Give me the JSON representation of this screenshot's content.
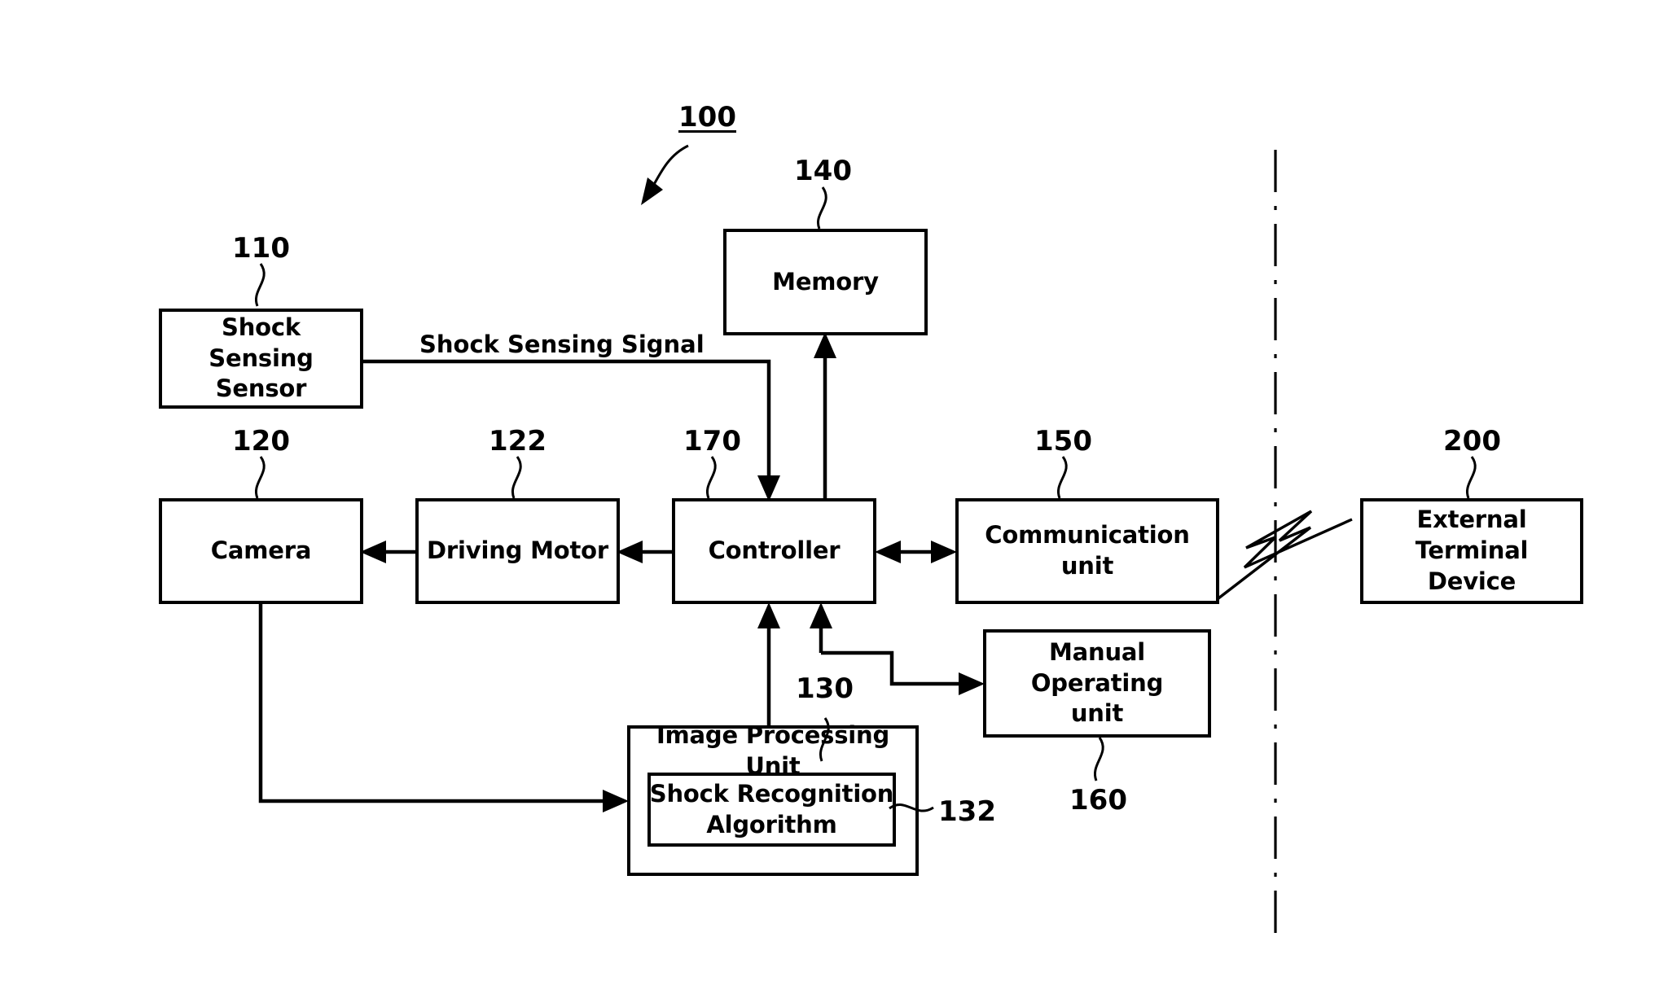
{
  "figure": {
    "system_ref": "100",
    "signal_labels": [
      {
        "id": "shock-sensing-signal",
        "text": "Shock Sensing Signal"
      }
    ]
  },
  "blocks": [
    {
      "id": "shock-sensing-sensor",
      "label": "Shock\nSensing Sensor",
      "ref": "110"
    },
    {
      "id": "camera",
      "label": "Camera",
      "ref": "120"
    },
    {
      "id": "driving-motor",
      "label": "Driving Motor",
      "ref": "122"
    },
    {
      "id": "controller",
      "label": "Controller",
      "ref": "170"
    },
    {
      "id": "memory",
      "label": "Memory",
      "ref": "140"
    },
    {
      "id": "communication-unit",
      "label": "Communication unit",
      "ref": "150"
    },
    {
      "id": "external-terminal",
      "label": "External Terminal\nDevice",
      "ref": "200"
    },
    {
      "id": "manual-operating-unit",
      "label": "Manual Operating\nunit",
      "ref": "160"
    },
    {
      "id": "image-processing-unit",
      "label": "Image Processing Unit",
      "ref": "130"
    },
    {
      "id": "shock-recognition-algorithm",
      "label": "Shock Recognition\nAlgorithm",
      "ref": "132"
    }
  ],
  "labels": {
    "shock_sensing_sensor": "Shock\nSensing Sensor",
    "camera": "Camera",
    "driving_motor": "Driving Motor",
    "controller": "Controller",
    "memory": "Memory",
    "communication_unit": "Communication unit",
    "external_terminal_device": "External Terminal\nDevice",
    "manual_operating_unit": "Manual Operating\nunit",
    "image_processing_unit": "Image Processing Unit",
    "shock_recognition_algorithm": "Shock Recognition\nAlgorithm",
    "shock_sensing_signal": "Shock Sensing Signal"
  },
  "refs": {
    "system": "100",
    "shock_sensing_sensor": "110",
    "camera": "120",
    "driving_motor": "122",
    "controller": "170",
    "memory": "140",
    "communication_unit": "150",
    "external_terminal_device": "200",
    "manual_operating_unit": "160",
    "image_processing_unit": "130",
    "shock_recognition_algorithm": "132"
  },
  "colors": {
    "stroke": "#000000",
    "fill": "#ffffff",
    "background": "#ffffff"
  }
}
